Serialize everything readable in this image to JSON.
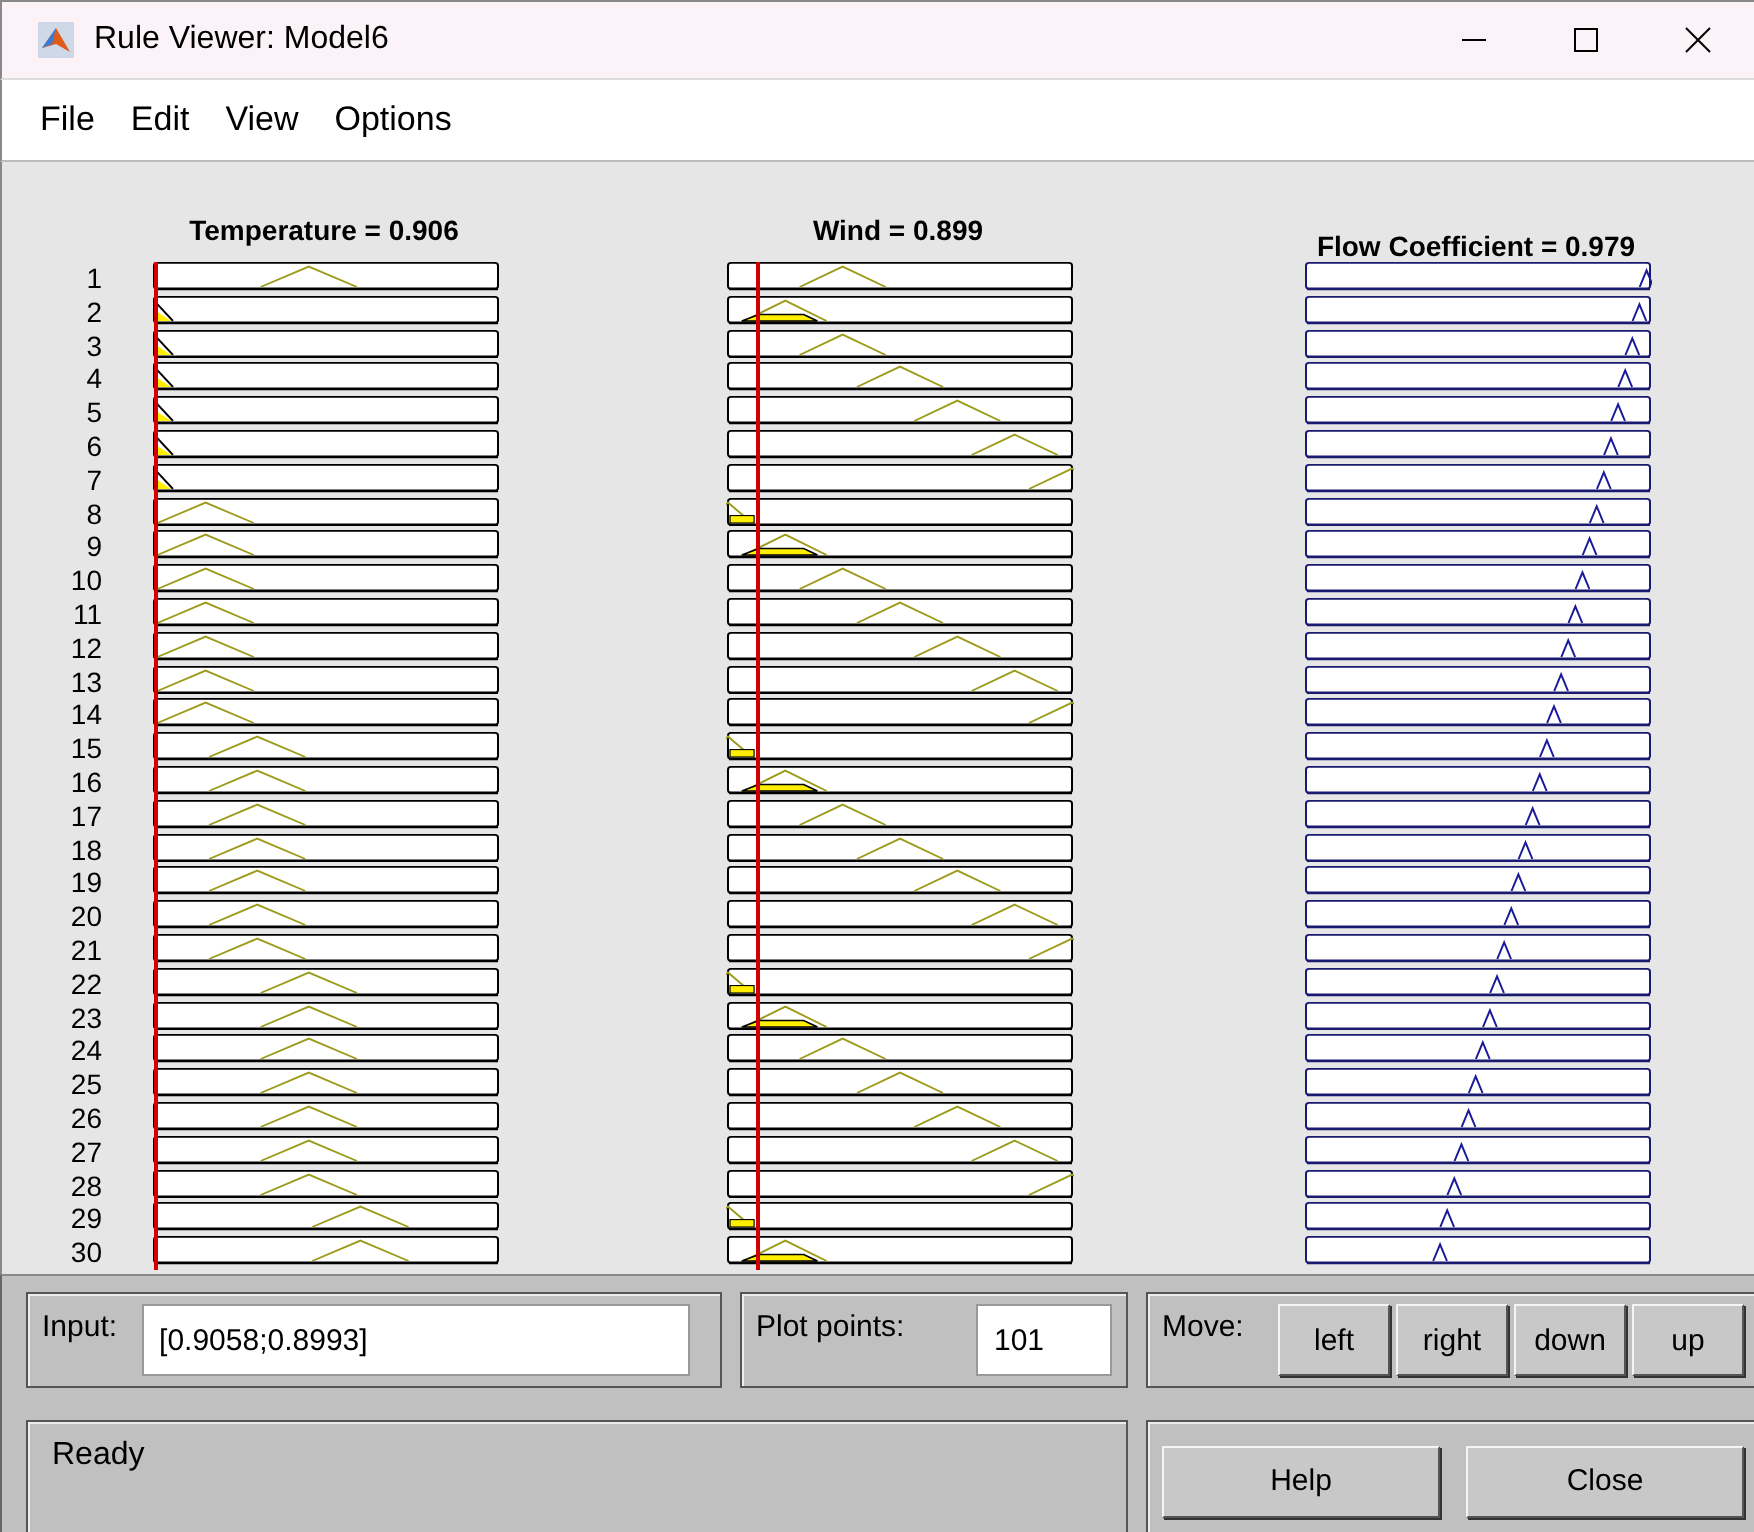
{
  "window": {
    "title": "Rule Viewer: Model6"
  },
  "menu": [
    "File",
    "Edit",
    "View",
    "Options"
  ],
  "plots": {
    "inputs": [
      {
        "label": "Temperature = 0.906"
      },
      {
        "label": "Wind = 0.899"
      }
    ],
    "output": {
      "label": "Flow Coefficient = 0.979"
    },
    "rule_numbers": [
      "1",
      "2",
      "3",
      "4",
      "5",
      "6",
      "7",
      "8",
      "9",
      "10",
      "11",
      "12",
      "13",
      "14",
      "15",
      "16",
      "17",
      "18",
      "19",
      "20",
      "21",
      "22",
      "23",
      "24",
      "25",
      "26",
      "27",
      "28",
      "29",
      "30"
    ]
  },
  "input": {
    "label": "Input:",
    "value": "[0.9058;0.8993]"
  },
  "plot_points": {
    "label": "Plot points:",
    "value": "101"
  },
  "move": {
    "label": "Move:",
    "buttons": [
      "left",
      "right",
      "down",
      "up"
    ]
  },
  "status": "Ready",
  "buttons": [
    "Help",
    "Close"
  ]
}
